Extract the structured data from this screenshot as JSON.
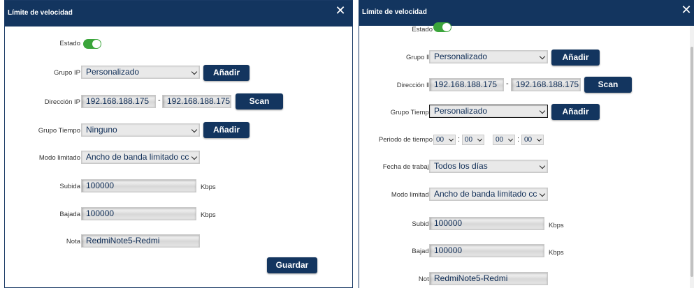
{
  "dialog": {
    "title": "Límite de velocidad",
    "close": "✕"
  },
  "labels": {
    "estado": "Estado",
    "grupo_ip": "Grupo IP",
    "direccion_ip": "Dirección IP",
    "grupo_tiempo": "Grupo Tiempo",
    "periodo": "Periodo de tiempo",
    "fecha": "Fecha de trabajo",
    "modo": "Modo limitado",
    "subida": "Subida",
    "bajada": "Bajada",
    "nota": "Nota",
    "unit": "Kbps",
    "dash": "-",
    "colon": ":"
  },
  "buttons": {
    "add": "Añadir",
    "scan": "Scan",
    "save": "Guardar"
  },
  "left": {
    "estado_on": true,
    "grupo_ip": "Personalizado",
    "ip_start": "192.168.188.175",
    "ip_end": "192.168.188.175",
    "grupo_tiempo": "Ninguno",
    "modo": "Ancho de banda limitado cc",
    "subida": "100000",
    "bajada": "100000",
    "nota": "RedmiNote5-Redmi"
  },
  "right": {
    "estado_on": true,
    "grupo_ip": "Personalizado",
    "ip_start": "192.168.188.175",
    "ip_end": "192.168.188.175",
    "grupo_tiempo": "Personalizado",
    "periodo": [
      "00",
      "00",
      "00",
      "00"
    ],
    "fecha": "Todos los días",
    "modo": "Ancho de banda limitado cc",
    "subida": "100000",
    "bajada": "100000",
    "nota": "RedmiNote5-Redmi"
  }
}
